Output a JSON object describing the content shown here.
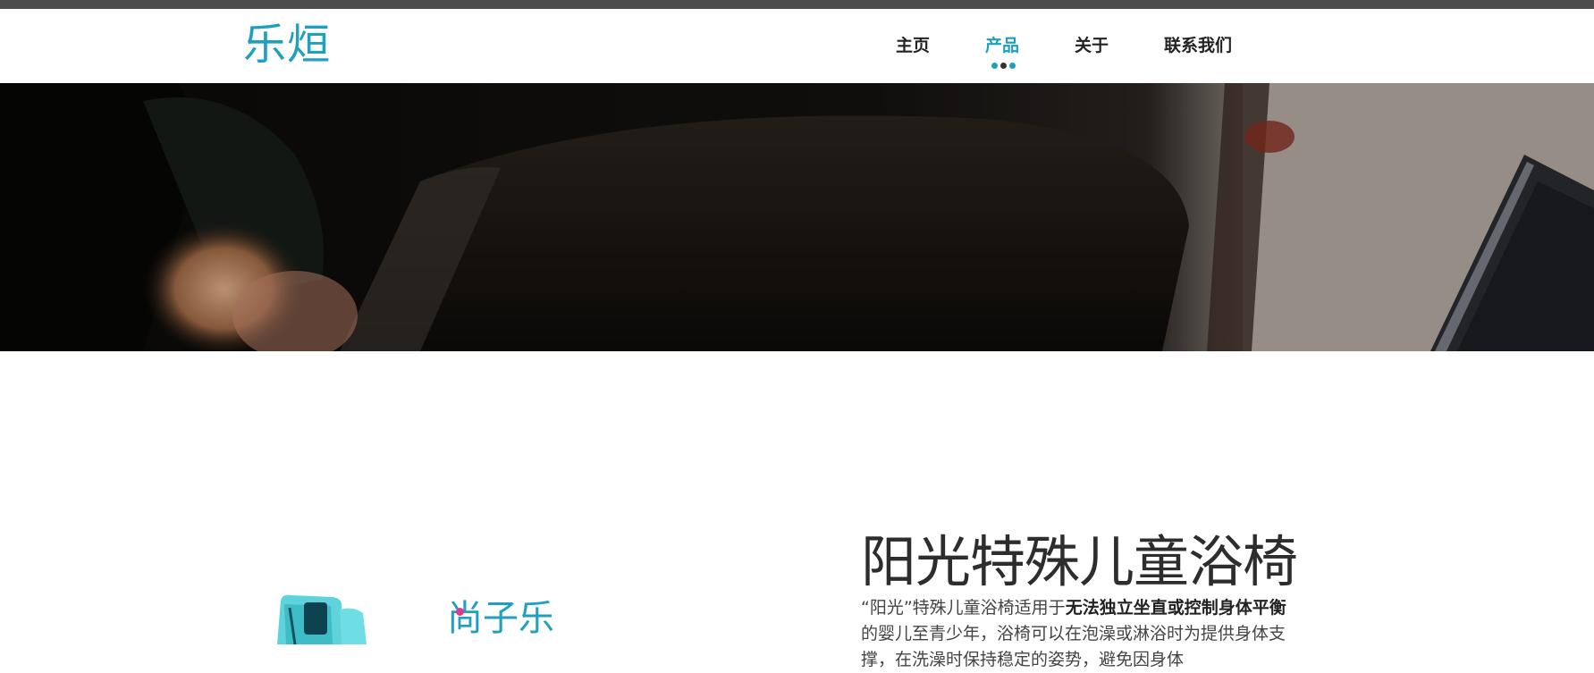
{
  "brand": {
    "logo_text": "乐烜"
  },
  "nav": {
    "items": [
      {
        "label": "主页"
      },
      {
        "label": "产品",
        "active": true
      },
      {
        "label": "关于"
      },
      {
        "label": "联系我们"
      }
    ]
  },
  "hero": {
    "image": "dark-blurred-photo-with-laptop"
  },
  "product": {
    "title": "阳光特殊儿童浴椅",
    "desc_intro": "“阳光”特殊儿童浴椅适用于",
    "desc_bold": "无法独立坐直或控制身体平衡",
    "desc_rest": "的婴儿至青少年，浴椅可以在泡澡或淋浴时为提供身体支撑，在洗澡时保持稳定的姿势，避免因身体",
    "image_brand_text": "尚子乐"
  },
  "colors": {
    "accent": "#1fa0bf",
    "top_strip": "#4d4d4d",
    "text_dark": "#222222",
    "dot_dark": "#333333"
  }
}
